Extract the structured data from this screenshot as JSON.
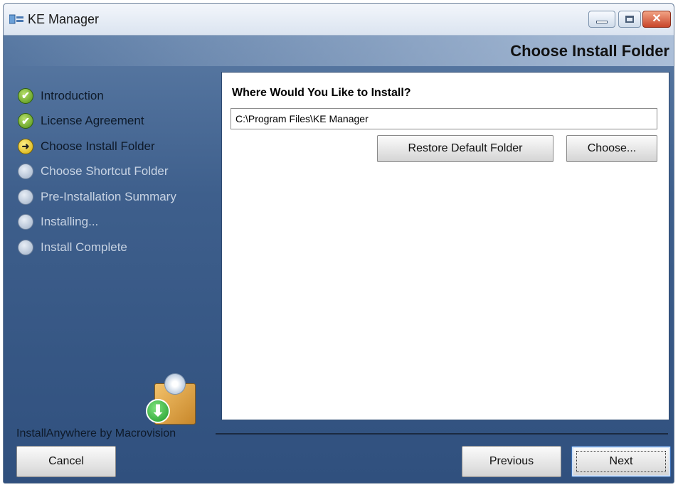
{
  "window": {
    "title": "KE Manager",
    "controls": {
      "minimize": "minimize-icon",
      "maximize": "maximize-icon",
      "close": "✕"
    }
  },
  "header": {
    "title": "Choose Install Folder"
  },
  "steps": [
    {
      "label": "Introduction",
      "state": "done",
      "icon": "✔"
    },
    {
      "label": "License Agreement",
      "state": "done",
      "icon": "✔"
    },
    {
      "label": "Choose Install Folder",
      "state": "current",
      "icon": "➜"
    },
    {
      "label": "Choose Shortcut Folder",
      "state": "pending",
      "icon": ""
    },
    {
      "label": "Pre-Installation Summary",
      "state": "pending",
      "icon": ""
    },
    {
      "label": "Installing...",
      "state": "pending",
      "icon": ""
    },
    {
      "label": "Install Complete",
      "state": "pending",
      "icon": ""
    }
  ],
  "vendor": "InstallAnywhere by Macrovision",
  "content": {
    "prompt": "Where Would You Like to Install?",
    "path_value": "C:\\Program Files\\KE Manager",
    "restore_label": "Restore Default Folder",
    "choose_label": "Choose..."
  },
  "footer": {
    "cancel_label": "Cancel",
    "previous_label": "Previous",
    "next_label": "Next"
  },
  "graphic": {
    "download_glyph": "⬇"
  }
}
